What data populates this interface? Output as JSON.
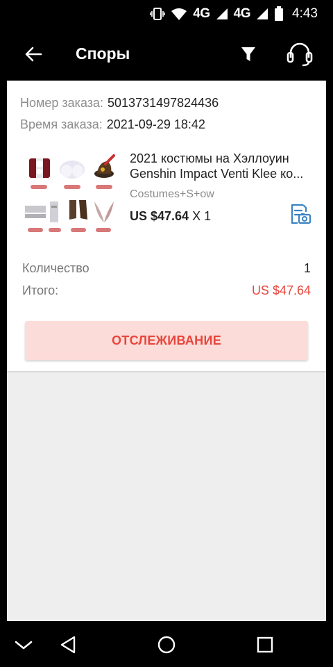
{
  "status_bar": {
    "network_1": "4G",
    "network_2": "4G",
    "time": "4:43",
    "icons": [
      "vibrate-icon",
      "wifi-icon",
      "signal-icon",
      "signal-icon",
      "battery-icon"
    ]
  },
  "app_bar": {
    "title": "Споры",
    "icons": [
      "back-arrow-icon",
      "filter-icon",
      "headset-icon"
    ]
  },
  "order": {
    "number_label": "Номер заказа:",
    "number_value": "5013731497824436",
    "time_label": "Время заказа:",
    "time_value": "2021-09-29 18:42",
    "product": {
      "title_line1": "2021 костюмы на Хэллоуин",
      "title_line2": "Genshin Impact Venti Klee ко...",
      "variant": "Costumes+S+ow",
      "price": "US $47.64",
      "qty": "X 1",
      "image_tags": [
        "dress",
        "pants",
        "hat",
        "scarf",
        "belt",
        "gloves",
        "ear"
      ]
    },
    "quantity_label": "Количество",
    "quantity_value": "1",
    "total_label": "Итого:",
    "total_value": "US $47.64",
    "track_button": "ОТСЛЕЖИВАНИЕ"
  },
  "colors": {
    "accent": "#e8453c",
    "button_bg": "#fcdcd8",
    "snapshot_icon": "#3b82c4"
  },
  "nav_bar": {
    "icons": [
      "chevron-down-icon",
      "back-triangle-icon",
      "home-circle-icon",
      "recents-square-icon"
    ]
  }
}
